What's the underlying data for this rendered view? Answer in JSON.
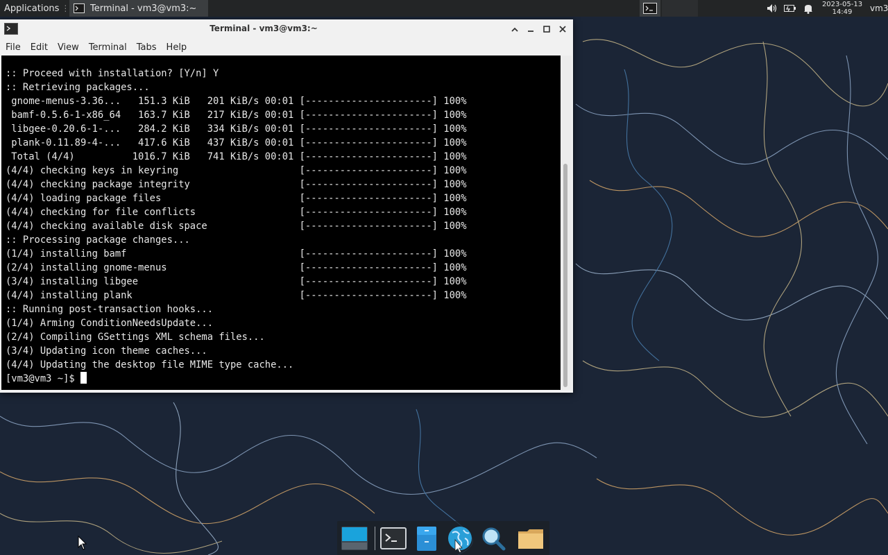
{
  "top_panel": {
    "applications_label": "Applications",
    "task_label": "Terminal - vm3@vm3:~",
    "clock_date": "2023-05-13",
    "clock_time": "14:49",
    "user": "vm3"
  },
  "window": {
    "title": "Terminal - vm3@vm3:~",
    "menu": [
      "File",
      "Edit",
      "View",
      "Terminal",
      "Tabs",
      "Help"
    ]
  },
  "terminal": {
    "lines": [
      ":: Proceed with installation? [Y/n] Y",
      ":: Retrieving packages...",
      " gnome-menus-3.36...   151.3 KiB   201 KiB/s 00:01 [----------------------] 100%",
      " bamf-0.5.6-1-x86_64   163.7 KiB   217 KiB/s 00:01 [----------------------] 100%",
      " libgee-0.20.6-1-...   284.2 KiB   334 KiB/s 00:01 [----------------------] 100%",
      " plank-0.11.89-4-...   417.6 KiB   437 KiB/s 00:01 [----------------------] 100%",
      " Total (4/4)          1016.7 KiB   741 KiB/s 00:01 [----------------------] 100%",
      "(4/4) checking keys in keyring                     [----------------------] 100%",
      "(4/4) checking package integrity                   [----------------------] 100%",
      "(4/4) loading package files                        [----------------------] 100%",
      "(4/4) checking for file conflicts                  [----------------------] 100%",
      "(4/4) checking available disk space                [----------------------] 100%",
      ":: Processing package changes...",
      "(1/4) installing bamf                              [----------------------] 100%",
      "(2/4) installing gnome-menus                       [----------------------] 100%",
      "(3/4) installing libgee                            [----------------------] 100%",
      "(4/4) installing plank                             [----------------------] 100%",
      ":: Running post-transaction hooks...",
      "(1/4) Arming ConditionNeedsUpdate...",
      "(2/4) Compiling GSettings XML schema files...",
      "(3/4) Updating icon theme caches...",
      "(4/4) Updating the desktop file MIME type cache..."
    ],
    "prompt": "[vm3@vm3 ~]$ "
  },
  "dock": {
    "items": [
      "show-desktop-icon",
      "terminal-icon",
      "file-manager-icon",
      "web-browser-icon",
      "app-finder-icon",
      "folder-icon"
    ]
  },
  "colors": {
    "panel_bg": "#232526",
    "desktop_bg": "#1b2536",
    "terminal_bg": "#000000",
    "terminal_fg": "#e8e8e8"
  }
}
